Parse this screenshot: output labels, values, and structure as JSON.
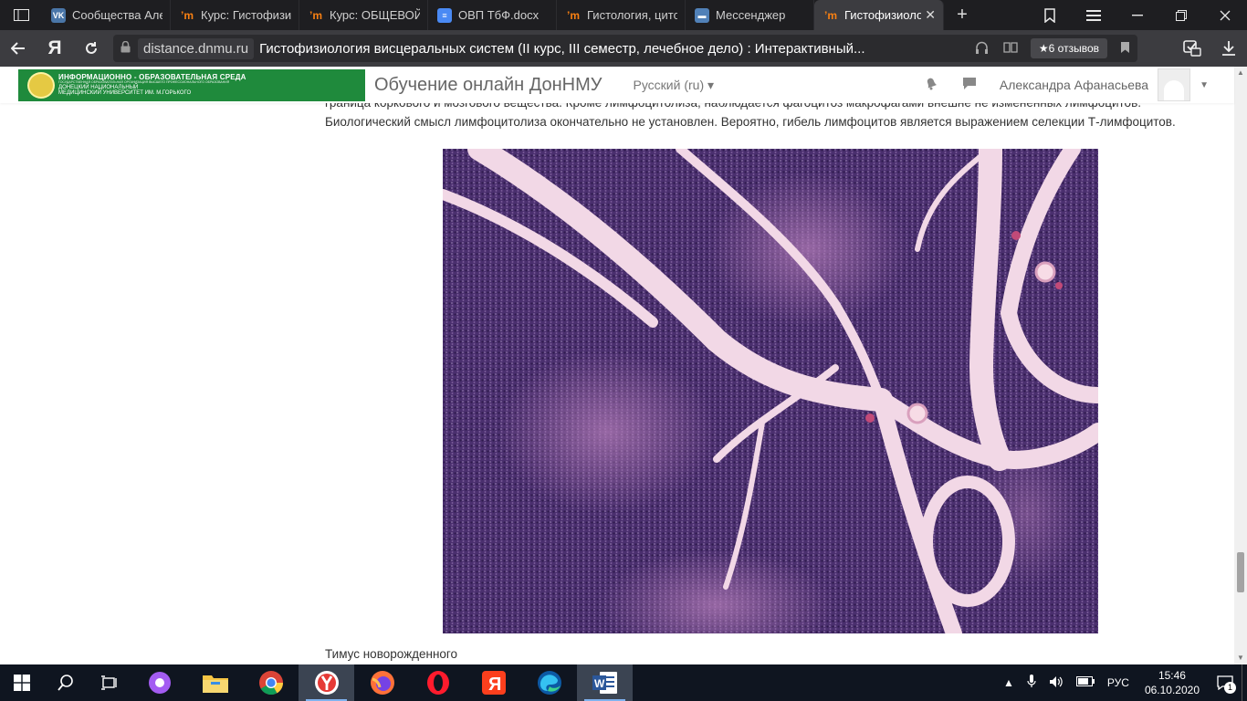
{
  "browser": {
    "tabs": [
      {
        "title": "Сообщества Але",
        "icon": "vk-icon"
      },
      {
        "title": "Курс: Гистофизи",
        "icon": "moodle-icon"
      },
      {
        "title": "Курс: ОБЩЕВОЙ",
        "icon": "moodle-icon"
      },
      {
        "title": "ОВП ТбФ.docx",
        "icon": "doc-icon"
      },
      {
        "title": "Гистология, цито",
        "icon": "moodle-icon"
      },
      {
        "title": "Мессенджер",
        "icon": "messenger-icon"
      },
      {
        "title": "Гистофизиоло",
        "icon": "moodle-icon",
        "active": true
      }
    ],
    "address": {
      "domain": "distance.dnmu.ru",
      "page_title": "Гистофизиология висцеральных систем (II курс, III семестр, лечебное дело) : Интерактивный...",
      "reviews": "6 отзывов"
    }
  },
  "site": {
    "logo_line1": "ИНФОРМАЦИОННО - ОБРАЗОВАТЕЛЬНАЯ СРЕДА",
    "logo_line2": "ГОСУДАРСТВЕННАЯ ОБРАЗОВАТЕЛЬНАЯ ОРГАНИЗАЦИЯ ВЫСШЕГО ПРОФЕССИОНАЛЬНОГО ОБРАЗОВАНИЯ",
    "logo_line3": "ДОНЕЦКИЙ НАЦИОНАЛЬНЫЙ",
    "logo_line4": "МЕДИЦИНСКИЙ УНИВЕРСИТЕТ ИМ. М.ГОРЬКОГО",
    "name": "Обучение онлайн ДонНМУ",
    "language": "Русский ‎(ru)‎",
    "user_name": "Александра Афанасьева"
  },
  "content": {
    "paragraph": "граница коркового и мозгового вещества. Кроме лимфоцитолиза, наблюдается фагоцитоз макрофагами внешне не измененных лимфоцитов. Биологический смысл лимфоцитолиза окончательно не установлен. Вероятно, гибель лимфоцитов является выражением селекции Т-лимфоцитов.",
    "caption": "Тимус новорожденного"
  },
  "taskbar": {
    "apps": [
      "alice",
      "file-explorer",
      "chrome",
      "yandex-browser",
      "firefox",
      "opera",
      "yandex",
      "edge",
      "word"
    ],
    "language": "РУС",
    "time": "15:46",
    "date": "06.10.2020",
    "notifications": "1"
  }
}
